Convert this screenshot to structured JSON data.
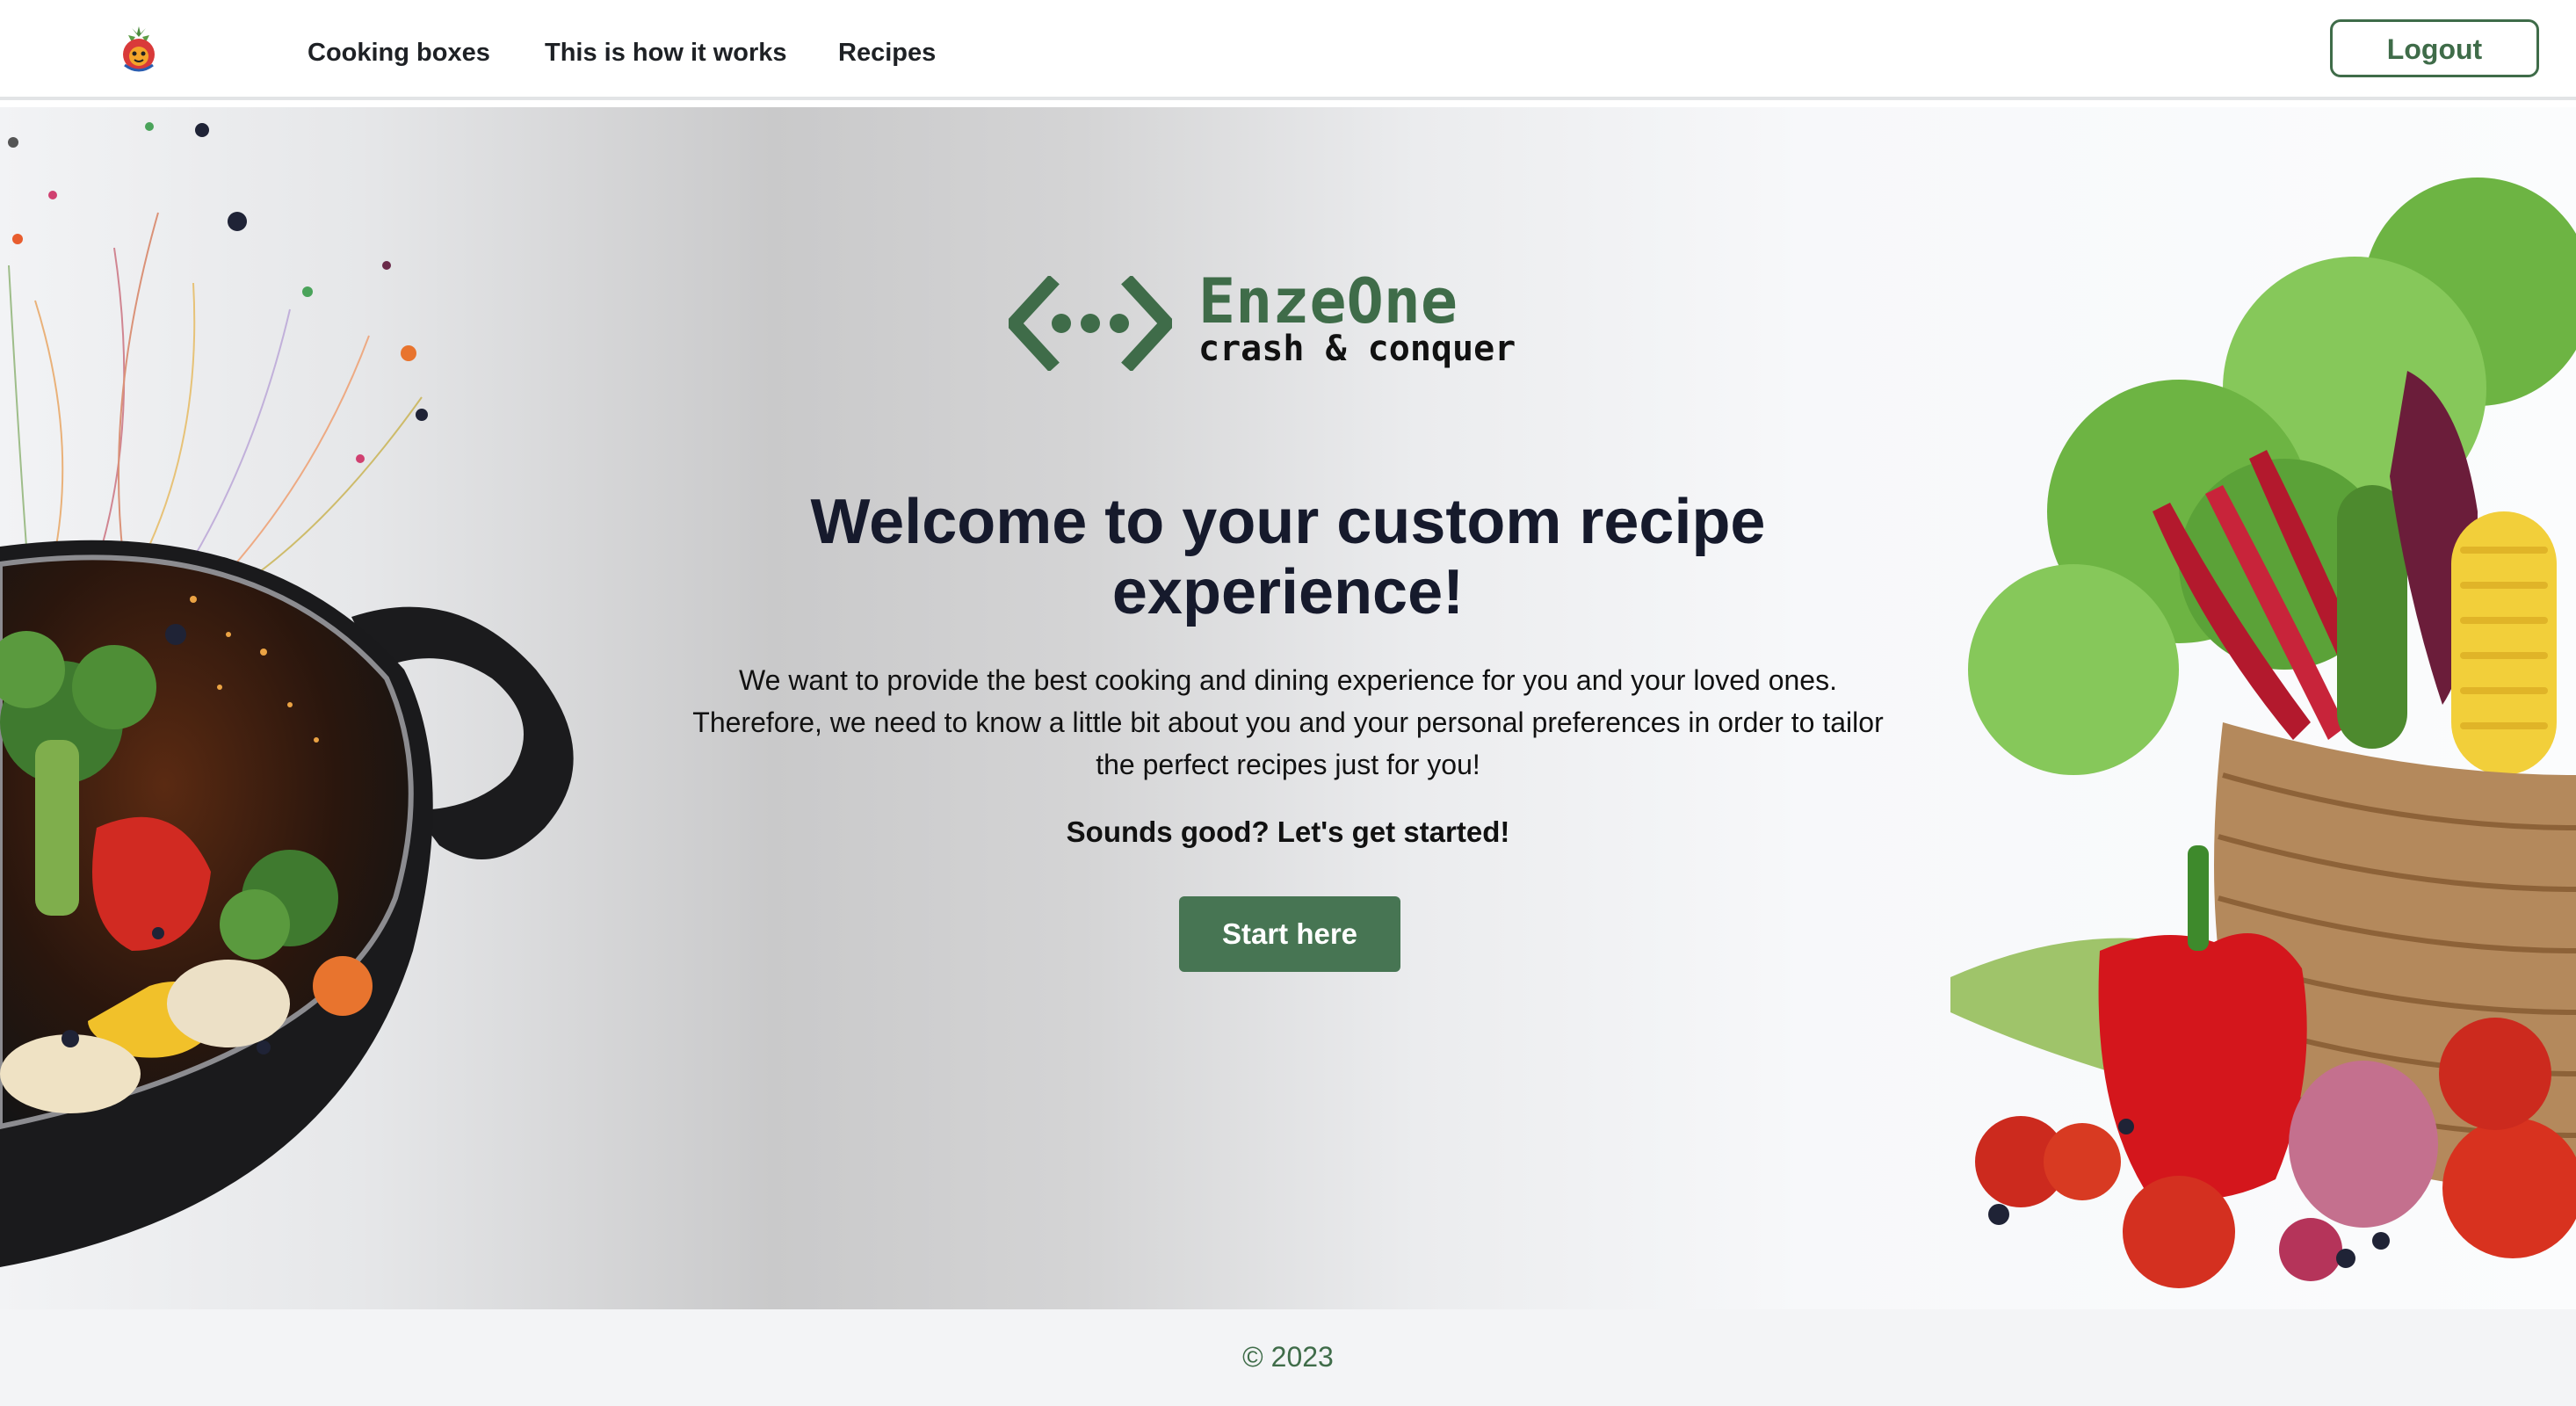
{
  "nav": {
    "logo_icon": "strawberry-mascot-icon",
    "links": [
      "Cooking boxes",
      "This is how it works",
      "Recipes"
    ],
    "logout_label": "Logout"
  },
  "hero": {
    "brand": {
      "icon": "code-brackets-dots-icon",
      "name": "EnzeOne",
      "tagline": "crash & conquer"
    },
    "title": "Welcome to your custom recipe experience!",
    "description": "We want to provide the best cooking and dining experience for you and your loved ones. Therefore, we need to know a little bit about you and your personal preferences in order to tailor the perfect recipes just for you!",
    "cta_text": "Sounds good? Let's get started!",
    "start_button": "Start here",
    "left_image": "cooking-pot-vegetables-image",
    "right_image": "vegetable-basket-image"
  },
  "footer": {
    "copyright": "© 2023"
  },
  "colors": {
    "brand_green": "#3f6c49",
    "button_green": "#477553",
    "heading": "#161a2c",
    "footer_bg": "#f3f4f6"
  }
}
